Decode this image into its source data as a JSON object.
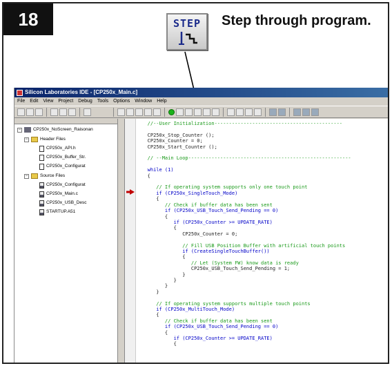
{
  "step": {
    "number": "18",
    "button_label": "STEP",
    "headline": "Step through program."
  },
  "ide": {
    "title": "Silicon Laboratories IDE - [CP250x_Main.c]",
    "menu": [
      "File",
      "Edit",
      "View",
      "Project",
      "Debug",
      "Tools",
      "Options",
      "Window",
      "Help"
    ],
    "project": {
      "root": "CP250x_NoScreen_Raisonan",
      "groups": [
        {
          "name": "Header Files",
          "files": [
            "CP250x_API.h",
            "CP250x_Buffer_Str.",
            "CP250x_Configurat"
          ]
        },
        {
          "name": "Source Files",
          "files": [
            "CP250x_Configurat",
            "CP250x_Main.c",
            "CP250x_USB_Desc",
            "STARTUP.A51"
          ]
        }
      ]
    },
    "code_lines": [
      "   //--User Initialization--------------------------------------------",
      "",
      "   CP250x_Stop_Counter ();",
      "   CP250x_Counter = 0;",
      "   CP250x_Start_Counter ();",
      "",
      "   // --Main Loop--------------------------------------------------------",
      "",
      "   while (1)",
      "   {",
      "",
      "      // If operating system supports only one touch point",
      "      if (CP250x_SingleTouch_Mode)",
      "      {",
      "         // Check if buffer data has been sent",
      "         if (CP250x_USB_Touch_Send_Pending == 0)",
      "         {",
      "            if (CP250x_Counter >= UPDATE_RATE)",
      "            {",
      "               CP250x_Counter = 0;",
      "",
      "               // Fill USB Position Buffer with artificial touch points",
      "               if (CreateSingleTouchBuffer())",
      "               {",
      "                  // Let (System FW) know data is ready",
      "                  CP250x_USB_Touch_Send_Pending = 1;",
      "               }",
      "            }",
      "         }",
      "      }",
      "",
      "      // If operating system supports multiple touch points",
      "      if (CP250x_MultiTouch_Mode)",
      "      {",
      "         // Check if buffer data has been sent",
      "         if (CP250x_USB_Touch_Send_Pending == 0)",
      "         {",
      "            if (CP250x_Counter >= UPDATE_RATE)",
      "            {"
    ]
  },
  "colors": {
    "step_bg": "#111111",
    "titlebar": "#0a246a",
    "comment": "#1a9a1a",
    "keyword": "#0000c8",
    "pc_marker": "#c00000"
  },
  "icons": {
    "step_button": "step-into-icon",
    "pc_marker": "program-counter-arrow-icon"
  }
}
